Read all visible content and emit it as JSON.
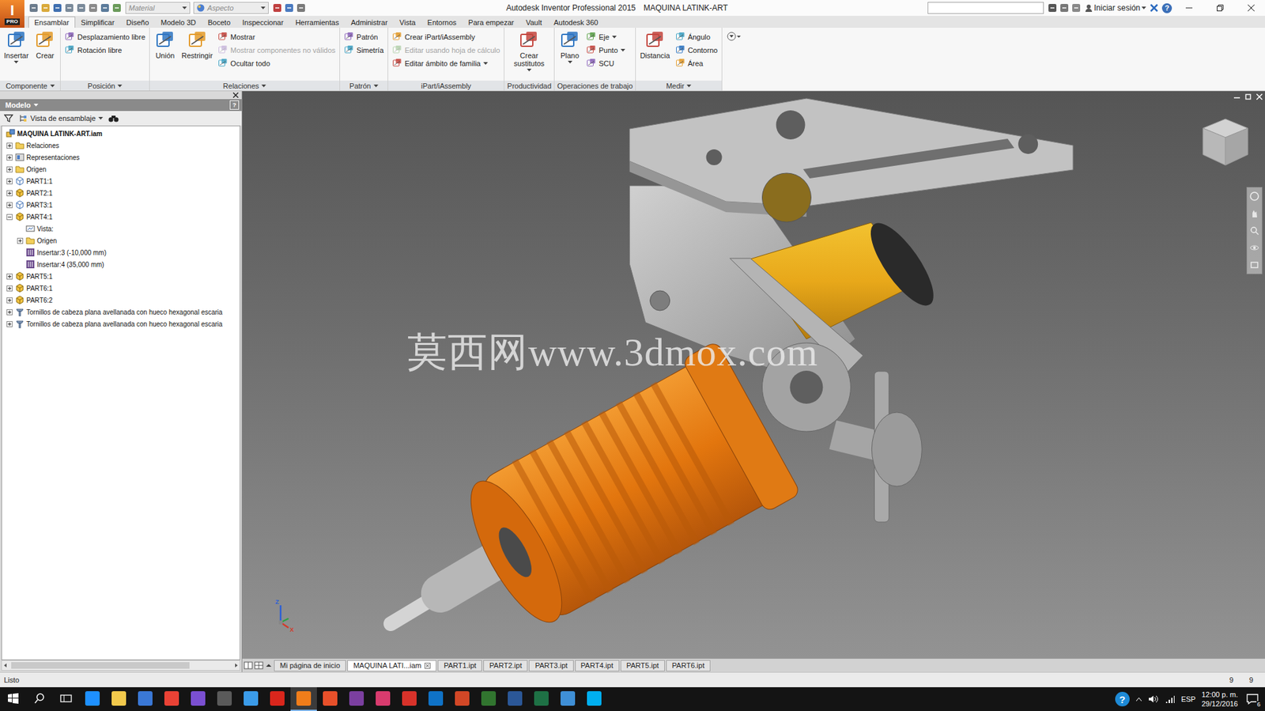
{
  "app": {
    "letter": "I",
    "badge": "PRO",
    "material": "Material",
    "appearance": "Aspecto",
    "title": "Autodesk Inventor Professional 2015",
    "document": "MAQUINA LATINK-ART",
    "sign_in": "Iniciar sesión",
    "help": "?"
  },
  "menu_tabs": [
    {
      "label": "Ensamblar",
      "selected": true
    },
    {
      "label": "Simplificar",
      "selected": false
    },
    {
      "label": "Diseño",
      "selected": false
    },
    {
      "label": "Modelo 3D",
      "selected": false
    },
    {
      "label": "Boceto",
      "selected": false
    },
    {
      "label": "Inspeccionar",
      "selected": false
    },
    {
      "label": "Herramientas",
      "selected": false
    },
    {
      "label": "Administrar",
      "selected": false
    },
    {
      "label": "Vista",
      "selected": false
    },
    {
      "label": "Entornos",
      "selected": false
    },
    {
      "label": "Para empezar",
      "selected": false
    },
    {
      "label": "Vault",
      "selected": false
    },
    {
      "label": "Autodesk 360",
      "selected": false
    }
  ],
  "ribbon": [
    {
      "title": "Componente",
      "dropdown": true,
      "groups": [
        {
          "kind": "large",
          "label": "Insertar",
          "menu": true,
          "items": []
        },
        {
          "kind": "large",
          "label": "Crear",
          "menu": false,
          "items": []
        }
      ]
    },
    {
      "title": "Posición",
      "dropdown": true,
      "groups": [
        {
          "kind": "stack",
          "label": "",
          "menu": false,
          "items": [
            {
              "label": "Desplazamiento libre",
              "disabled": false,
              "menu": false
            },
            {
              "label": "Rotación libre",
              "disabled": false,
              "menu": false
            }
          ]
        }
      ]
    },
    {
      "title": "Relaciones",
      "dropdown": true,
      "groups": [
        {
          "kind": "large",
          "label": "Unión",
          "menu": false,
          "items": []
        },
        {
          "kind": "large",
          "label": "Restringir",
          "menu": false,
          "items": []
        },
        {
          "kind": "stack",
          "label": "",
          "menu": false,
          "items": [
            {
              "label": "Mostrar",
              "disabled": false,
              "menu": false
            },
            {
              "label": "Mostrar componentes no válidos",
              "disabled": true,
              "menu": false
            },
            {
              "label": "Ocultar todo",
              "disabled": false,
              "menu": false
            }
          ]
        }
      ]
    },
    {
      "title": "Patrón",
      "dropdown": true,
      "groups": [
        {
          "kind": "stack",
          "label": "",
          "menu": false,
          "items": [
            {
              "label": "Patrón",
              "disabled": false,
              "menu": false
            },
            {
              "label": "Simetría",
              "disabled": false,
              "menu": false
            }
          ]
        }
      ]
    },
    {
      "title": "iPart/iAssembly",
      "dropdown": false,
      "groups": [
        {
          "kind": "stack",
          "label": "",
          "menu": false,
          "items": [
            {
              "label": "Crear iPart/iAssembly",
              "disabled": false,
              "menu": false
            },
            {
              "label": "Editar usando hoja de cálculo",
              "disabled": true,
              "menu": false
            },
            {
              "label": "Editar ámbito de familia",
              "disabled": false,
              "menu": true
            }
          ]
        }
      ]
    },
    {
      "title": "Productividad",
      "dropdown": false,
      "groups": [
        {
          "kind": "large",
          "label": "Crear sustitutos",
          "menu": true,
          "items": []
        }
      ]
    },
    {
      "title": "Operaciones de trabajo",
      "dropdown": false,
      "groups": [
        {
          "kind": "large",
          "label": "Plano",
          "menu": true,
          "items": []
        },
        {
          "kind": "stack",
          "label": "",
          "menu": false,
          "items": [
            {
              "label": "Eje",
              "disabled": false,
              "menu": true
            },
            {
              "label": "Punto",
              "disabled": false,
              "menu": true
            },
            {
              "label": "SCU",
              "disabled": false,
              "menu": false
            }
          ]
        }
      ]
    },
    {
      "title": "Medir",
      "dropdown": true,
      "groups": [
        {
          "kind": "large",
          "label": "Distancia",
          "menu": false,
          "items": []
        },
        {
          "kind": "stack",
          "label": "",
          "menu": false,
          "items": [
            {
              "label": "Ángulo",
              "disabled": false,
              "menu": false
            },
            {
              "label": "Contorno",
              "disabled": false,
              "menu": false
            },
            {
              "label": "Área",
              "disabled": false,
              "menu": false
            }
          ]
        }
      ]
    }
  ],
  "browser": {
    "title": "Modelo",
    "help": "?",
    "view": "Vista de ensamblaje",
    "tree": [
      {
        "label": "MAQUINA LATINK-ART.iam",
        "level": 0,
        "kind": "root",
        "expandable": false,
        "expanded": false,
        "bold": true
      },
      {
        "label": "Relaciones",
        "level": 0,
        "kind": "folder",
        "expandable": true,
        "expanded": false,
        "bold": false
      },
      {
        "label": "Representaciones",
        "level": 0,
        "kind": "representations",
        "expandable": true,
        "expanded": false,
        "bold": false
      },
      {
        "label": "Origen",
        "level": 0,
        "kind": "folder",
        "expandable": true,
        "expanded": false,
        "bold": false
      },
      {
        "label": "PART1:1",
        "level": 0,
        "kind": "part-alt",
        "expandable": true,
        "expanded": false,
        "bold": false
      },
      {
        "label": "PART2:1",
        "level": 0,
        "kind": "part",
        "expandable": true,
        "expanded": false,
        "bold": false
      },
      {
        "label": "PART3:1",
        "level": 0,
        "kind": "part-alt",
        "expandable": true,
        "expanded": false,
        "bold": false
      },
      {
        "label": "PART4:1",
        "level": 0,
        "kind": "part",
        "expandable": true,
        "expanded": true,
        "bold": false
      },
      {
        "label": "Vista:",
        "level": 1,
        "kind": "view",
        "expandable": false,
        "expanded": false,
        "bold": false
      },
      {
        "label": "Origen",
        "level": 1,
        "kind": "folder",
        "expandable": true,
        "expanded": false,
        "bold": false
      },
      {
        "label": "Insertar:3 (-10,000 mm)",
        "level": 1,
        "kind": "constraint",
        "expandable": false,
        "expanded": false,
        "bold": false
      },
      {
        "label": "Insertar:4 (35,000 mm)",
        "level": 1,
        "kind": "constraint",
        "expandable": false,
        "expanded": false,
        "bold": false
      },
      {
        "label": "PART5:1",
        "level": 0,
        "kind": "part",
        "expandable": true,
        "expanded": false,
        "bold": false
      },
      {
        "label": "PART6:1",
        "level": 0,
        "kind": "part",
        "expandable": true,
        "expanded": false,
        "bold": false
      },
      {
        "label": "PART6:2",
        "level": 0,
        "kind": "part",
        "expandable": true,
        "expanded": false,
        "bold": false
      },
      {
        "label": "Tornillos de cabeza plana avellanada con hueco hexagonal escaria",
        "level": 0,
        "kind": "fastener",
        "expandable": true,
        "expanded": false,
        "bold": false
      },
      {
        "label": "Tornillos de cabeza plana avellanada con hueco hexagonal escaria",
        "level": 0,
        "kind": "fastener",
        "expandable": true,
        "expanded": false,
        "bold": false
      }
    ]
  },
  "viewport": {
    "watermark": "莫西网www.3dmox.com",
    "axes": [
      "Z",
      "X"
    ]
  },
  "doc_tabs": [
    {
      "label": "Mi página de inicio",
      "selected": false,
      "closable": false
    },
    {
      "label": "MAQUINA LATI...iam",
      "selected": true,
      "closable": true
    },
    {
      "label": "PART1.ipt",
      "selected": false,
      "closable": false
    },
    {
      "label": "PART2.ipt",
      "selected": false,
      "closable": false
    },
    {
      "label": "PART3.ipt",
      "selected": false,
      "closable": false
    },
    {
      "label": "PART4.ipt",
      "selected": false,
      "closable": false
    },
    {
      "label": "PART5.ipt",
      "selected": false,
      "closable": false
    },
    {
      "label": "PART6.ipt",
      "selected": false,
      "closable": false
    }
  ],
  "status_bar": {
    "text": "Listo",
    "counts": [
      "9",
      "9"
    ]
  },
  "taskbar": {
    "apps": [
      {
        "active": false
      },
      {
        "active": false
      },
      {
        "active": false
      },
      {
        "active": false
      },
      {
        "active": false
      },
      {
        "active": false
      },
      {
        "active": false
      },
      {
        "active": false
      },
      {
        "active": true
      },
      {
        "active": false
      },
      {
        "active": false
      },
      {
        "active": false
      },
      {
        "active": false
      },
      {
        "active": false
      },
      {
        "active": false
      },
      {
        "active": false
      },
      {
        "active": false
      },
      {
        "active": false
      },
      {
        "active": false
      },
      {
        "active": false
      }
    ],
    "help": "?",
    "language": "ESP",
    "time": "12:00 p. m.",
    "date": "29/12/2016",
    "notifications": "6"
  }
}
